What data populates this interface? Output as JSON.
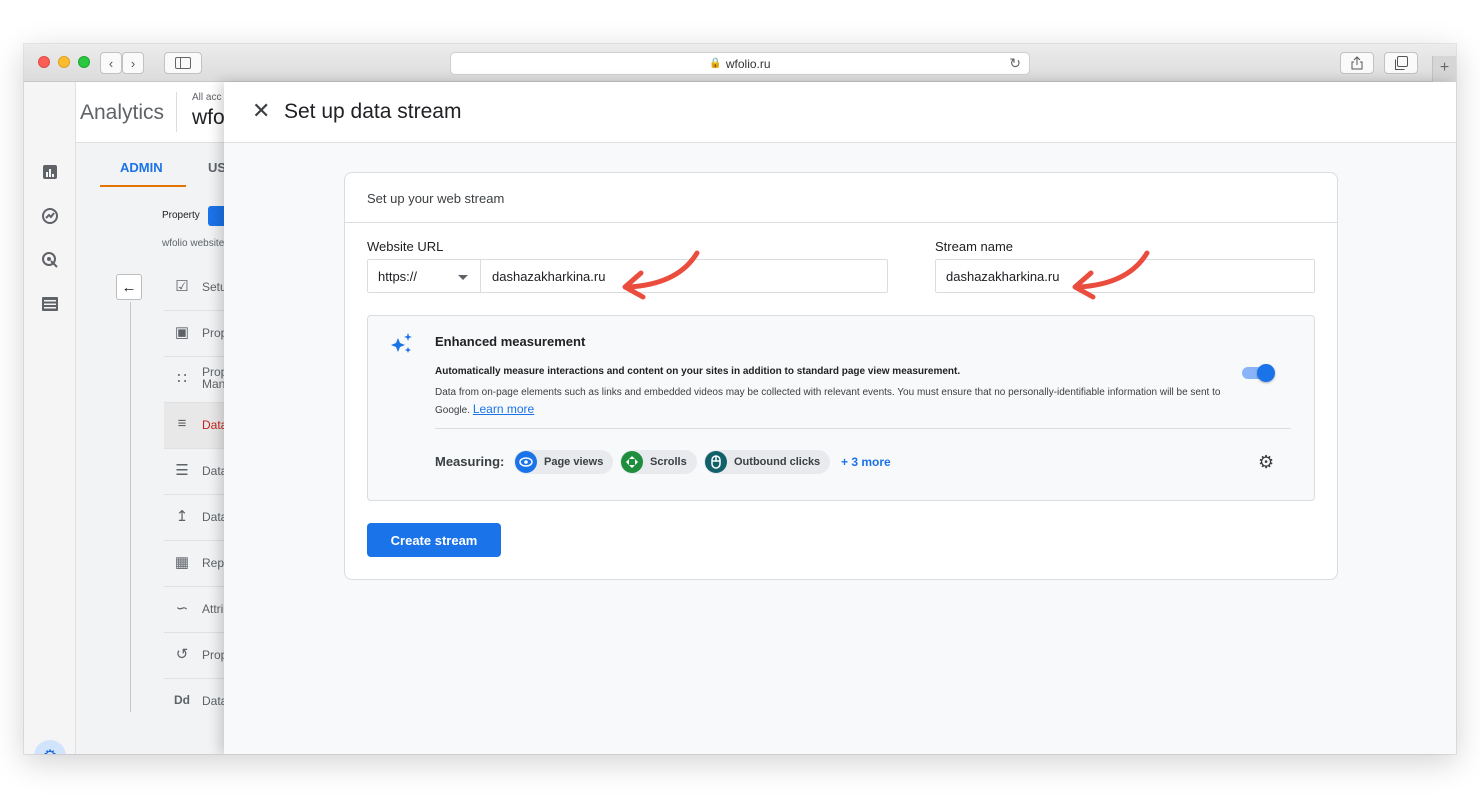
{
  "browser": {
    "url": "wfolio.ru",
    "lock_icon": "lock-icon",
    "reload_icon": "reload-icon",
    "new_tab": "+"
  },
  "app": {
    "brand": "Analytics",
    "account_small": "All acc",
    "account_big": "wfo",
    "tabs": {
      "admin": "ADMIN",
      "user": "US"
    },
    "property_label": "Property",
    "property_site": "wfolio website",
    "nav_items": [
      {
        "label": "Setu",
        "icon": "checklist-icon"
      },
      {
        "label": "Prop",
        "icon": "panel-icon"
      },
      {
        "label": "Prop\nMan",
        "icon": "people-icon"
      },
      {
        "label": "Data",
        "icon": "streams-icon"
      },
      {
        "label": "Data",
        "icon": "database-icon"
      },
      {
        "label": "Data",
        "icon": "upload-icon"
      },
      {
        "label": "Rep",
        "icon": "report-icon"
      },
      {
        "label": "Attri",
        "icon": "attribution-icon"
      },
      {
        "label": "Prop",
        "icon": "history-icon"
      },
      {
        "label": "Data",
        "icon": "dd-icon"
      }
    ]
  },
  "dialog": {
    "title": "Set up data stream",
    "card_title": "Set up your web stream",
    "website_url_label": "Website URL",
    "protocol": "https://",
    "website_url_value": "dashazakharkina.ru",
    "stream_name_label": "Stream name",
    "stream_name_value": "dashazakharkina.ru",
    "enhanced": {
      "title": "Enhanced measurement",
      "line1": "Automatically measure interactions and content on your sites in addition to standard page view measurement.",
      "line2": "Data from on-page elements such as links and embedded videos may be collected with relevant events. You must ensure that no personally-identifiable information will be sent to Google.",
      "learn_more": "Learn more",
      "toggle_on": true,
      "measuring_label": "Measuring:",
      "chips": [
        {
          "label": "Page views",
          "icon": "eye-icon",
          "color": "#1a73e8"
        },
        {
          "label": "Scrolls",
          "icon": "scroll-icon",
          "color": "#1e8e3e"
        },
        {
          "label": "Outbound clicks",
          "icon": "mouse-icon",
          "color": "#12606a"
        }
      ],
      "more": "+ 3 more"
    },
    "create_button": "Create stream"
  },
  "colors": {
    "accent": "#1a73e8",
    "annotation_arrow": "#ea4d3d",
    "logo_orange": "#f9ab00",
    "logo_dark": "#e37400"
  }
}
